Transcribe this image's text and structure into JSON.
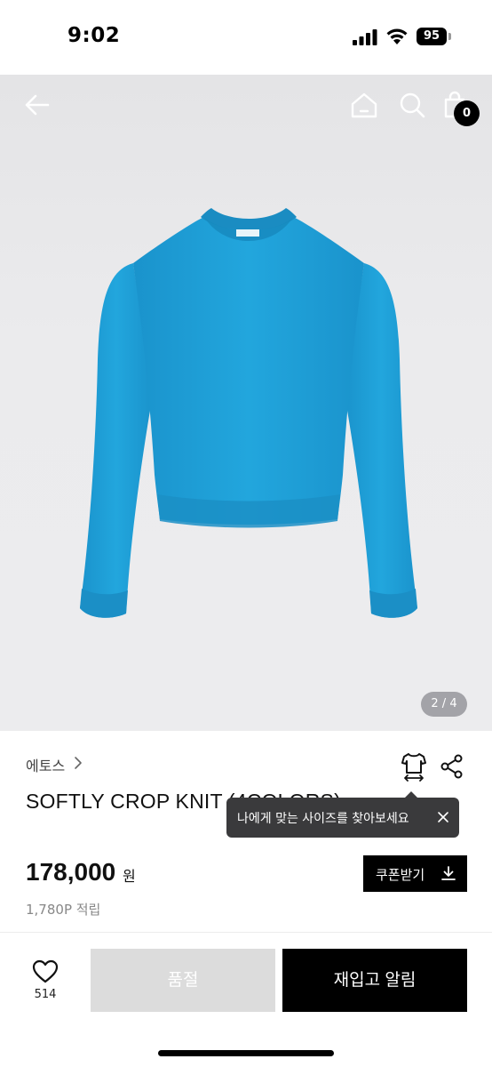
{
  "status_bar": {
    "time": "9:02",
    "battery": "95"
  },
  "nav": {
    "cart_count": "0"
  },
  "gallery": {
    "page_indicator": "2 / 4",
    "image_label": "ETHOS"
  },
  "product": {
    "brand": "에토스",
    "name": "SOFTLY CROP KNIT (4COLORS)",
    "price": "178,000",
    "price_unit": "원",
    "points": "1,780P 적립"
  },
  "tooltip": {
    "text": "나에게 맞는 사이즈를 찾아보세요"
  },
  "actions": {
    "coupon_label": "쿠폰받기",
    "like_count": "514",
    "soldout_label": "품절",
    "restock_label": "재입고 알림"
  },
  "colors": {
    "accent": "#000000",
    "sweater": "#1f9fd6",
    "soldout_bg": "#dcdcdc",
    "tooltip_bg": "#3a3a3c"
  },
  "icons": [
    "back-arrow-icon",
    "home-icon",
    "search-icon",
    "shopping-bag-icon",
    "size-guide-icon",
    "share-icon",
    "close-icon",
    "download-icon",
    "heart-icon",
    "chevron-right-icon"
  ]
}
